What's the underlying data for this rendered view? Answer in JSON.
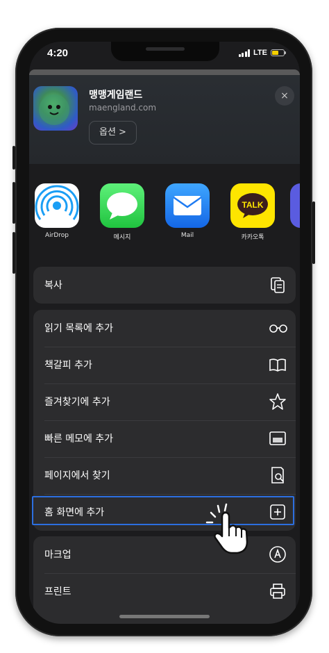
{
  "status_bar": {
    "time": "4:20",
    "network": "LTE"
  },
  "share_header": {
    "site_title": "맹맹게임랜드",
    "site_url": "maengland.com",
    "options_label": "옵션 >",
    "close_icon": "×"
  },
  "apps": [
    {
      "label": "AirDrop",
      "icon": "airdrop-icon"
    },
    {
      "label": "메시지",
      "icon": "messages-icon"
    },
    {
      "label": "Mail",
      "icon": "mail-icon"
    },
    {
      "label": "카카오톡",
      "icon": "kakaotalk-icon"
    }
  ],
  "app_badges": {
    "kakao_text": "TALK"
  },
  "actions": {
    "copy": "복사",
    "reading_list": "읽기 목록에 추가",
    "bookmark": "책갈피 추가",
    "favorites": "즐겨찾기에 추가",
    "quick_note": "빠른 메모에 추가",
    "find_in_page": "페이지에서 찾기",
    "add_to_home": "홈 화면에 추가",
    "markup": "마크업",
    "print": "프린트"
  },
  "colors": {
    "highlight": "#2c6fe0",
    "airdrop": "#1a9ef5",
    "messages": "#34c759",
    "mail": "#1e7bf2",
    "kakao": "#fee500"
  }
}
